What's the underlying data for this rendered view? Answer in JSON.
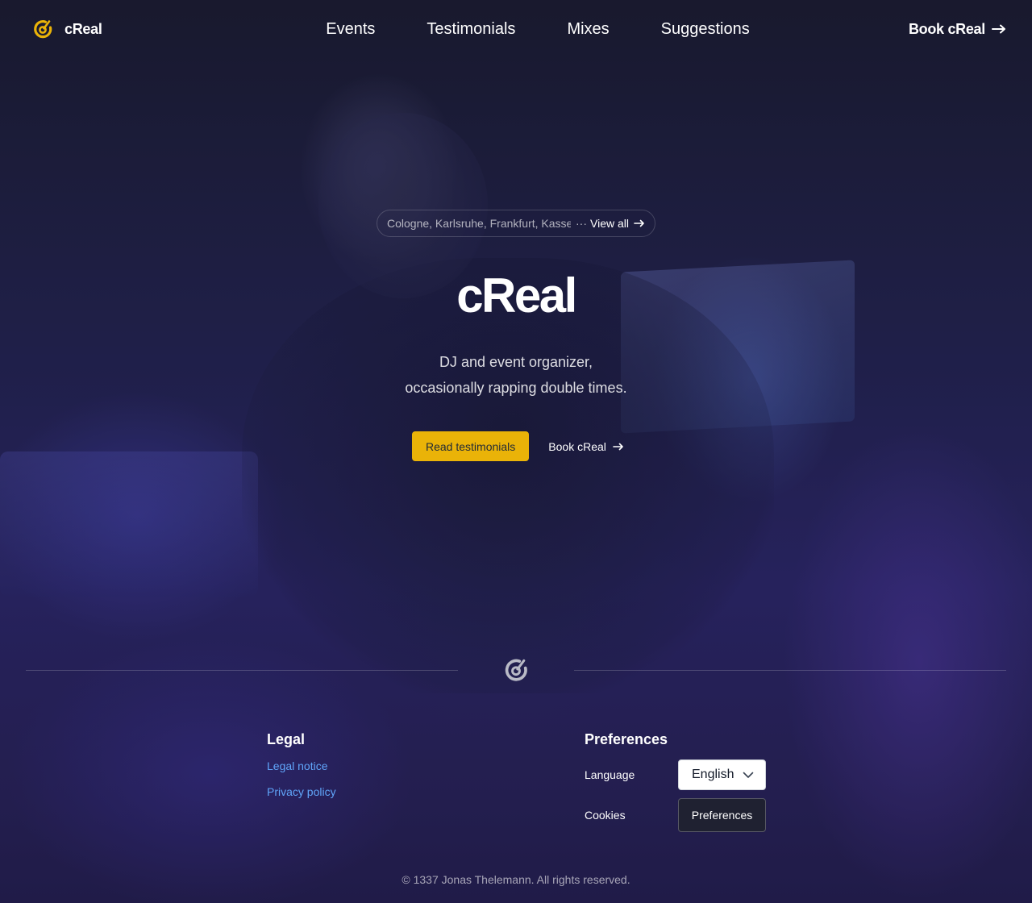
{
  "brand": {
    "name": "cReal",
    "accent_color": "#eab308",
    "logo_icon": "logo-icon"
  },
  "nav": {
    "items": [
      {
        "label": "Events"
      },
      {
        "label": "Testimonials"
      },
      {
        "label": "Mixes"
      },
      {
        "label": "Suggestions"
      }
    ],
    "book_label": "Book cReal",
    "book_icon": "arrow-right-icon"
  },
  "hero": {
    "cities": "Cologne, Karlsruhe, Frankfurt, Kassel,",
    "cities_more": "···",
    "view_all_label": "View all",
    "title": "cReal",
    "subtitle_line1": "DJ and event organizer,",
    "subtitle_line2": "occasionally rapping double times.",
    "primary_cta": "Read testimonials",
    "secondary_cta": "Book cReal"
  },
  "footer": {
    "legal": {
      "title": "Legal",
      "links": [
        {
          "label": "Legal notice",
          "color": "#60a5fa"
        },
        {
          "label": "Privacy policy",
          "color": "#60a5fa"
        }
      ]
    },
    "preferences": {
      "title": "Preferences",
      "language_label": "Language",
      "language_value": "English",
      "cookies_label": "Cookies",
      "cookies_button": "Preferences"
    },
    "copyright": "© 1337 Jonas Thelemann. All rights reserved."
  }
}
